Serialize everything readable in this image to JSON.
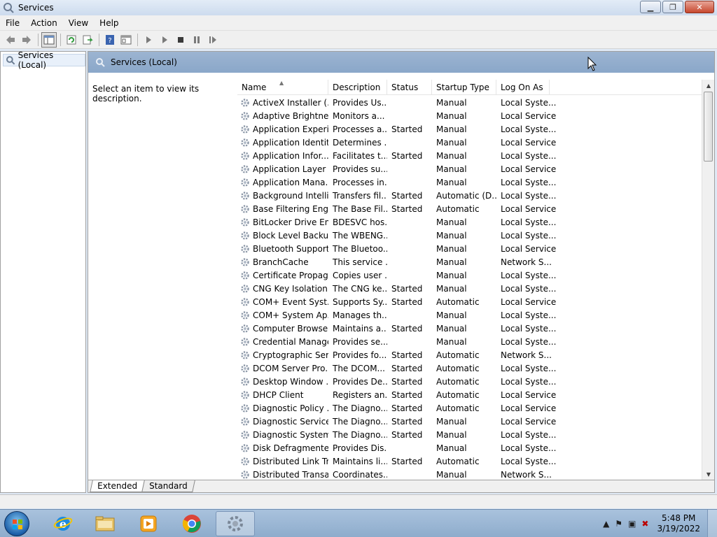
{
  "window": {
    "title": "Services",
    "minimize_glyph": "▁",
    "maximize_glyph": "❐",
    "close_glyph": "✕"
  },
  "menu": [
    "File",
    "Action",
    "View",
    "Help"
  ],
  "toolbar": {
    "icons": [
      "back-arrow-icon",
      "forward-arrow-icon",
      "show-hide-tree-icon",
      "refresh-icon",
      "export-list-icon",
      "help-icon",
      "properties-icon",
      "start-service-icon",
      "start-alt-icon",
      "stop-service-icon",
      "pause-service-icon",
      "restart-service-icon"
    ]
  },
  "tree": {
    "items": [
      {
        "label": "Services (Local)",
        "icon": "gear-magnifier-icon"
      }
    ]
  },
  "panel": {
    "header": "Services (Local)",
    "description_placeholder": "Select an item to view its description."
  },
  "table": {
    "columns": [
      "Name",
      "Description",
      "Status",
      "Startup Type",
      "Log On As"
    ],
    "rows": [
      [
        "ActiveX Installer (...",
        "Provides Us...",
        "",
        "Manual",
        "Local Syste..."
      ],
      [
        "Adaptive Brightness",
        "Monitors a...",
        "",
        "Manual",
        "Local Service"
      ],
      [
        "Application Experi...",
        "Processes a...",
        "Started",
        "Manual",
        "Local Syste..."
      ],
      [
        "Application Identity",
        "Determines ...",
        "",
        "Manual",
        "Local Service"
      ],
      [
        "Application Infor...",
        "Facilitates t...",
        "Started",
        "Manual",
        "Local Syste..."
      ],
      [
        "Application Layer ...",
        "Provides su...",
        "",
        "Manual",
        "Local Service"
      ],
      [
        "Application Mana...",
        "Processes in...",
        "",
        "Manual",
        "Local Syste..."
      ],
      [
        "Background Intelli...",
        "Transfers fil...",
        "Started",
        "Automatic (D...",
        "Local Syste..."
      ],
      [
        "Base Filtering Engi...",
        "The Base Fil...",
        "Started",
        "Automatic",
        "Local Service"
      ],
      [
        "BitLocker Drive En...",
        "BDESVC hos...",
        "",
        "Manual",
        "Local Syste..."
      ],
      [
        "Block Level Backu...",
        "The WBENG...",
        "",
        "Manual",
        "Local Syste..."
      ],
      [
        "Bluetooth Support...",
        "The Bluetoo...",
        "",
        "Manual",
        "Local Service"
      ],
      [
        "BranchCache",
        "This service ...",
        "",
        "Manual",
        "Network S..."
      ],
      [
        "Certificate Propag...",
        "Copies user ...",
        "",
        "Manual",
        "Local Syste..."
      ],
      [
        "CNG Key Isolation",
        "The CNG ke...",
        "Started",
        "Manual",
        "Local Syste..."
      ],
      [
        "COM+ Event Syst...",
        "Supports Sy...",
        "Started",
        "Automatic",
        "Local Service"
      ],
      [
        "COM+ System Ap...",
        "Manages th...",
        "",
        "Manual",
        "Local Syste..."
      ],
      [
        "Computer Browser",
        "Maintains a...",
        "Started",
        "Manual",
        "Local Syste..."
      ],
      [
        "Credential Manager",
        "Provides se...",
        "",
        "Manual",
        "Local Syste..."
      ],
      [
        "Cryptographic Ser...",
        "Provides fo...",
        "Started",
        "Automatic",
        "Network S..."
      ],
      [
        "DCOM Server Pro...",
        "The DCOM...",
        "Started",
        "Automatic",
        "Local Syste..."
      ],
      [
        "Desktop Window ...",
        "Provides De...",
        "Started",
        "Automatic",
        "Local Syste..."
      ],
      [
        "DHCP Client",
        "Registers an...",
        "Started",
        "Automatic",
        "Local Service"
      ],
      [
        "Diagnostic Policy ...",
        "The Diagno...",
        "Started",
        "Automatic",
        "Local Service"
      ],
      [
        "Diagnostic Service...",
        "The Diagno...",
        "Started",
        "Manual",
        "Local Service"
      ],
      [
        "Diagnostic System...",
        "The Diagno...",
        "Started",
        "Manual",
        "Local Syste..."
      ],
      [
        "Disk Defragmenter",
        "Provides Dis...",
        "",
        "Manual",
        "Local Syste..."
      ],
      [
        "Distributed Link Tr...",
        "Maintains li...",
        "Started",
        "Automatic",
        "Local Syste..."
      ],
      [
        "Distributed Transa...",
        "Coordinates...",
        "",
        "Manual",
        "Network S..."
      ]
    ]
  },
  "tabs": [
    {
      "label": "Extended",
      "active": true
    },
    {
      "label": "Standard",
      "active": false
    }
  ],
  "taskbar": {
    "apps": [
      "internet-explorer-icon",
      "file-explorer-icon",
      "media-player-icon",
      "chrome-icon",
      "services-icon"
    ],
    "time": "5:48 PM",
    "date": "3/19/2022"
  },
  "colors": {
    "panel_header": "#8fabcb",
    "taskbar": "#9bb8d6"
  }
}
